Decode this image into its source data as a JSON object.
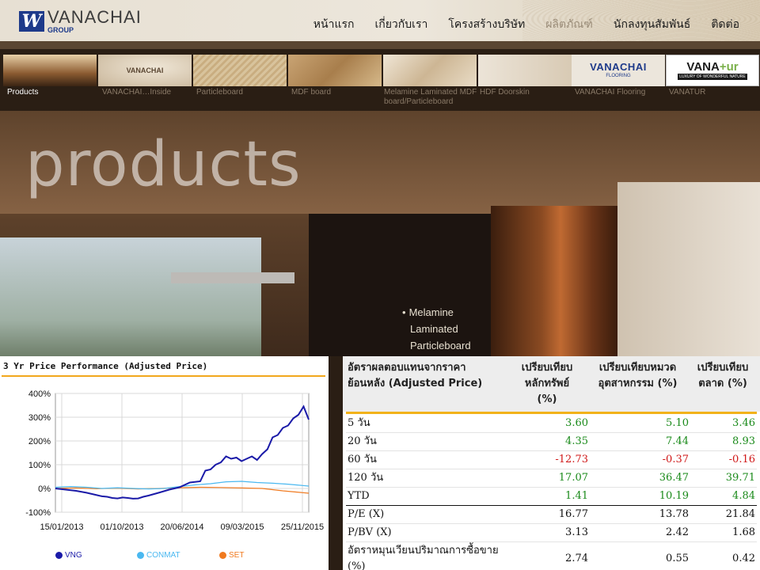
{
  "header": {
    "logo": {
      "mark": "W",
      "name": "VANACHAI",
      "sub": "GROUP"
    },
    "nav": [
      {
        "label": "หน้าแรก",
        "active": false
      },
      {
        "label": "เกี่ยวกับเรา",
        "active": false
      },
      {
        "label": "โครงสร้างบริษัท",
        "active": false
      },
      {
        "label": "ผลิตภัณฑ์",
        "active": true
      },
      {
        "label": "นักลงทุนสัมพันธ์",
        "active": false
      },
      {
        "label": "ติดต่อ",
        "active": false
      }
    ]
  },
  "thumbnails": [
    {
      "label": "Products",
      "active": true
    },
    {
      "label": "VANACHAI…Inside",
      "active": false
    },
    {
      "label": "Particleboard",
      "active": false
    },
    {
      "label": "MDF board",
      "active": false
    },
    {
      "label": "Melamine Laminated MDF board/Particleboard",
      "active": false
    },
    {
      "label": "HDF Doorskin",
      "active": false
    },
    {
      "label": "VANACHAI Flooring",
      "active": false
    },
    {
      "label": "VANATUR",
      "active": false
    }
  ],
  "thumb_brands": {
    "vanachai_inside": "VANACHAI",
    "flooring_name": "VANACHAI",
    "flooring_sub": "FLOORING",
    "vanatur_a": "VANA",
    "vanatur_b": "+ur",
    "vanatur_sub": "LUXURY OF WONDERFUL NATURE"
  },
  "hero": {
    "title": "products",
    "caption": [
      "Melamine",
      "Laminated",
      "Particleboard"
    ]
  },
  "chart_data": {
    "type": "line",
    "title": "3 Yr Price Performance (Adjusted Price)",
    "x_ticks": [
      "15/01/2013",
      "01/10/2013",
      "20/06/2014",
      "09/03/2015",
      "25/11/2015"
    ],
    "y_ticks": [
      "400%",
      "300%",
      "200%",
      "100%",
      "0%",
      "-100%"
    ],
    "ylim": [
      -100,
      400
    ],
    "grid": true,
    "legend_position": "bottom",
    "series": [
      {
        "name": "VNG",
        "color": "#1a1aa8",
        "x": [
          0,
          2,
          4,
          6,
          8,
          9,
          10,
          11,
          12,
          13,
          14,
          15,
          16,
          17,
          18,
          20,
          22,
          24,
          26,
          28,
          29,
          30,
          31,
          32,
          33,
          34,
          35,
          36,
          37,
          38,
          39,
          40,
          41,
          42,
          43,
          44,
          45,
          46,
          47,
          48,
          49
        ],
        "y": [
          0,
          -5,
          -10,
          -18,
          -28,
          -33,
          -35,
          -40,
          -42,
          -38,
          -40,
          -43,
          -42,
          -35,
          -30,
          -18,
          -5,
          5,
          25,
          30,
          75,
          80,
          100,
          110,
          135,
          125,
          130,
          115,
          125,
          135,
          120,
          145,
          165,
          215,
          225,
          255,
          265,
          295,
          310,
          345,
          290
        ]
      },
      {
        "name": "CONMAT",
        "color": "#4ab8f0",
        "x": [
          0,
          3,
          6,
          9,
          12,
          15,
          18,
          21,
          24,
          27,
          30,
          33,
          36,
          39,
          42,
          45,
          49
        ],
        "y": [
          5,
          8,
          5,
          0,
          3,
          0,
          -2,
          0,
          8,
          15,
          20,
          28,
          30,
          25,
          22,
          18,
          10
        ]
      },
      {
        "name": "SET",
        "color": "#f07a20",
        "x": [
          0,
          4,
          8,
          12,
          16,
          20,
          24,
          28,
          32,
          36,
          40,
          44,
          49
        ],
        "y": [
          0,
          2,
          -1,
          1,
          -2,
          0,
          3,
          5,
          4,
          2,
          0,
          -10,
          -20
        ]
      }
    ]
  },
  "returns_table": {
    "headers": [
      "อัตราผลตอบแทนจากราคาย้อนหลัง (Adjusted Price)",
      "เปรียบเทียบหลักทรัพย์ (%)",
      "เปรียบเทียบหมวดอุตสาหกรรม (%)",
      "เปรียบเทียบตลาด (%)"
    ],
    "header_lines": {
      "col0": [
        "อัตราผลตอบแทนจากราคา",
        "ย้อนหลัง (Adjusted Price)"
      ],
      "col1": [
        "เปรียบเทียบ",
        "หลักทรัพย์",
        "(%)"
      ],
      "col2": [
        "เปรียบเทียบหมวด",
        "อุตสาหกรรม (%)"
      ],
      "col3": [
        "เปรียบเทียบ",
        "ตลาด (%)"
      ]
    },
    "rows": [
      {
        "label": "5 วัน",
        "values": [
          "3.60",
          "5.10",
          "3.46"
        ],
        "signs": [
          "pos",
          "pos",
          "pos"
        ]
      },
      {
        "label": "20 วัน",
        "values": [
          "4.35",
          "7.44",
          "8.93"
        ],
        "signs": [
          "pos",
          "pos",
          "pos"
        ]
      },
      {
        "label": "60 วัน",
        "values": [
          "-12.73",
          "-0.37",
          "-0.16"
        ],
        "signs": [
          "neg",
          "neg",
          "neg"
        ]
      },
      {
        "label": "120 วัน",
        "values": [
          "17.07",
          "36.47",
          "39.71"
        ],
        "signs": [
          "pos",
          "pos",
          "pos"
        ]
      },
      {
        "label": "YTD",
        "values": [
          "1.41",
          "10.19",
          "4.84"
        ],
        "signs": [
          "pos",
          "pos",
          "pos"
        ]
      },
      {
        "label": "P/E (X)",
        "values": [
          "16.77",
          "13.78",
          "21.84"
        ],
        "signs": [
          "",
          "",
          ""
        ]
      },
      {
        "label": "P/BV (X)",
        "values": [
          "3.13",
          "2.42",
          "1.68"
        ],
        "signs": [
          "",
          "",
          ""
        ]
      },
      {
        "label": "อัตราหมุนเวียนปริมาณการซื้อขาย (%)",
        "label_lines": [
          "อัตราหมุนเวียนปริมาณการซื้อขาย",
          "(%)"
        ],
        "values": [
          "2.74",
          "0.55",
          "0.42"
        ],
        "signs": [
          "",
          "",
          ""
        ]
      }
    ]
  }
}
